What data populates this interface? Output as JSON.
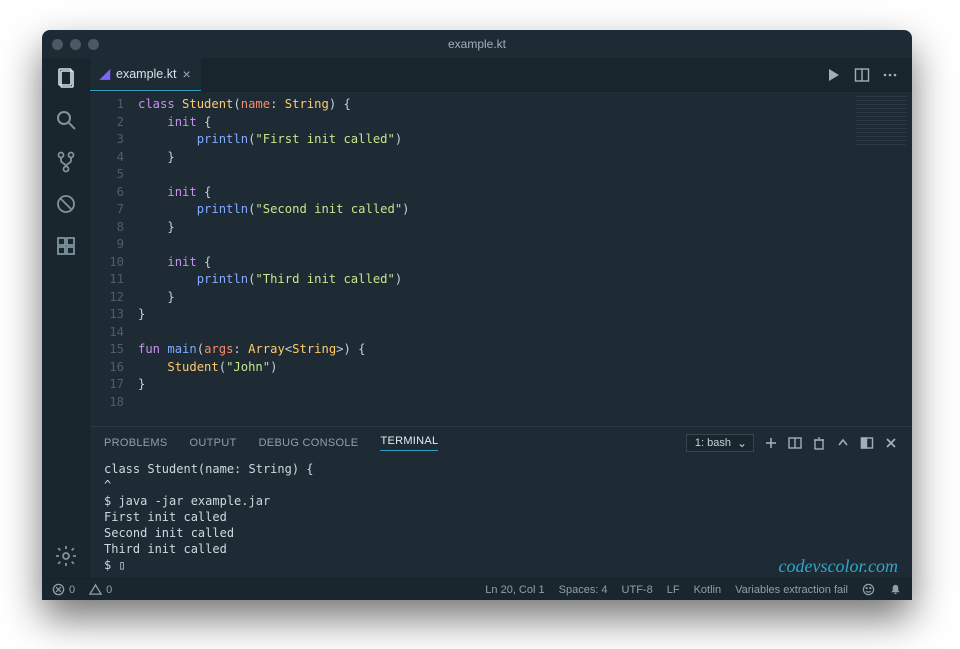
{
  "titlebar": {
    "title": "example.kt"
  },
  "tab": {
    "filename": "example.kt"
  },
  "code": {
    "lines": [
      {
        "n": "1",
        "html": "<span class='kw'>class</span> <span class='cls'>Student</span>(<span class='param'>name</span>: <span class='type'>String</span>) {"
      },
      {
        "n": "2",
        "html": "    <span class='kw'>init</span> {"
      },
      {
        "n": "3",
        "html": "        <span class='fn'>println</span>(<span class='str'>\"First init called\"</span>)"
      },
      {
        "n": "4",
        "html": "    }"
      },
      {
        "n": "5",
        "html": ""
      },
      {
        "n": "6",
        "html": "    <span class='kw'>init</span> {"
      },
      {
        "n": "7",
        "html": "        <span class='fn'>println</span>(<span class='str'>\"Second init called\"</span>)"
      },
      {
        "n": "8",
        "html": "    }"
      },
      {
        "n": "9",
        "html": ""
      },
      {
        "n": "10",
        "html": "    <span class='kw'>init</span> {"
      },
      {
        "n": "11",
        "html": "        <span class='fn'>println</span>(<span class='str'>\"Third init called\"</span>)"
      },
      {
        "n": "12",
        "html": "    }"
      },
      {
        "n": "13",
        "html": "}"
      },
      {
        "n": "14",
        "html": ""
      },
      {
        "n": "15",
        "html": "<span class='kw'>fun</span> <span class='fn'>main</span>(<span class='param'>args</span>: <span class='type'>Array</span>&lt;<span class='type'>String</span>&gt;) {"
      },
      {
        "n": "16",
        "html": "    <span class='cls'>Student</span>(<span class='str'>\"John\"</span>)"
      },
      {
        "n": "17",
        "html": "}"
      },
      {
        "n": "18",
        "html": ""
      }
    ]
  },
  "panel": {
    "tabs": {
      "problems": "PROBLEMS",
      "output": "OUTPUT",
      "debug": "DEBUG CONSOLE",
      "terminal": "TERMINAL"
    },
    "term_select": "1: bash",
    "terminal_lines": [
      "class Student(name: String) {",
      "      ^",
      "$ java -jar example.jar",
      "First init called",
      "Second init called",
      "Third init called",
      "$ ▯"
    ]
  },
  "watermark": "codevscolor.com",
  "status": {
    "errors": "0",
    "warnings": "0",
    "position": "Ln 20, Col 1",
    "spaces": "Spaces: 4",
    "encoding": "UTF-8",
    "eol": "LF",
    "lang": "Kotlin",
    "msg": "Variables extraction fail"
  }
}
